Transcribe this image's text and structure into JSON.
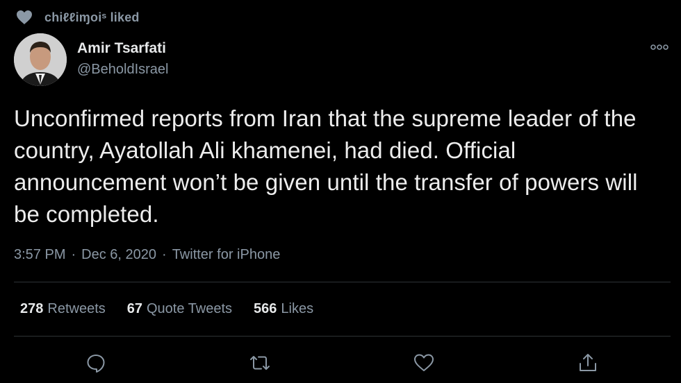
{
  "context": {
    "liked_by": "chiℓℓiɱoiˢ",
    "liked_suffix": "liked"
  },
  "author": {
    "name": "Amir Tsarfati",
    "handle": "@BeholdIsrael"
  },
  "tweet": {
    "text": "Unconfirmed reports from Iran that the supreme leader of the country, Ayatollah Ali khamenei, had died. Official announcement won’t be given until the transfer of powers will be completed.",
    "time": "3:57 PM",
    "date": "Dec 6, 2020",
    "source": "Twitter for iPhone",
    "separator": "·"
  },
  "stats": {
    "retweets_count": "278",
    "retweets_label": "Retweets",
    "quotes_count": "67",
    "quotes_label": "Quote Tweets",
    "likes_count": "566",
    "likes_label": "Likes"
  },
  "colors": {
    "background": "#000000",
    "text_primary": "#e7e9ea",
    "text_secondary": "#8b98a5",
    "divider": "#2f3336"
  },
  "icons": {
    "liked": "heart-icon",
    "more": "more-options-icon",
    "reply": "reply-icon",
    "retweet": "retweet-icon",
    "like": "like-icon",
    "share": "share-icon"
  }
}
